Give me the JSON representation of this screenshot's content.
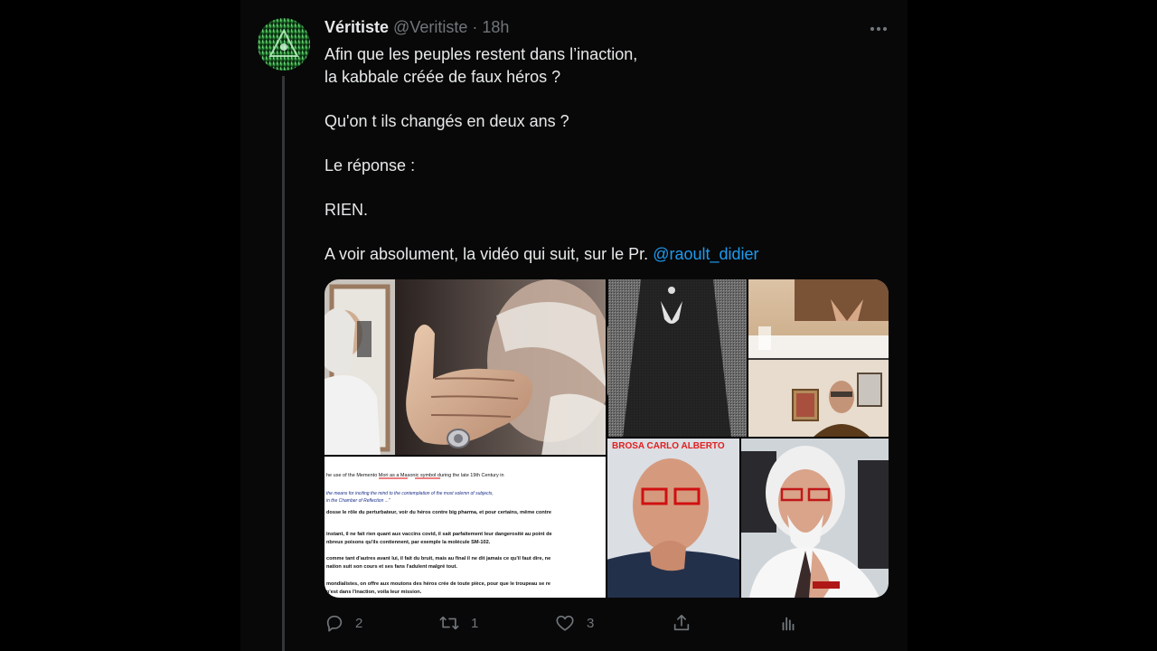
{
  "tweet": {
    "author": {
      "display_name": "Véritiste",
      "handle": "@Veritiste",
      "separator": "·",
      "time": "18h"
    },
    "text_lines": [
      "Afin que les peuples restent dans l’inaction,",
      "la kabbale créée de faux héros ?",
      "Qu'on t ils changés en deux ans ?",
      "Le réponse :",
      "RIEN.",
      "A voir absolument, la vidéo qui suit, sur le Pr."
    ],
    "mention": "@raoult_didier",
    "media": {
      "overlay_label": "BROSA CARLO ALBERTO",
      "document_lines": [
        "he use of the Memento Mori as a Masonic symbol during the late 19th Century in",
        "the means for inciting the mind to the contemplation of the most solemn of subjects,",
        "in the Chamber of Reflection ...\"",
        "dosse le rôle du perturbateur, voir du héros contre big pharma, et pour certains, même contre",
        "instant, il ne fait rien quant aux vaccins covid, il sait parfaitement leur dangerosité au point de",
        "nbreux poisons qu'ils contiennent, par exemple la molécule SM-102.",
        "comme tant d'autres avant lui, il fait du bruit, mais au final il ne dit jamais ce qu'il faut dire, ne",
        "nation suit son cours et ses fans l'adulent malgré tout.",
        "mondialistes, on offre aux moutons des héros crée de toute pièce, pour que le troupeau se re",
        "n'est dans l'inaction, voila leur mission."
      ]
    },
    "actions": {
      "replies": "2",
      "retweets": "1",
      "likes": "3"
    }
  },
  "icons": {
    "reply": "reply-icon",
    "retweet": "retweet-icon",
    "like": "heart-icon",
    "share": "share-icon",
    "analytics": "analytics-icon",
    "more": "more-icon"
  },
  "colors": {
    "background": "#000000",
    "text": "#e7e9ea",
    "secondary": "#71767b",
    "link": "#1d9bf0",
    "overlay_label": "#e02020"
  }
}
